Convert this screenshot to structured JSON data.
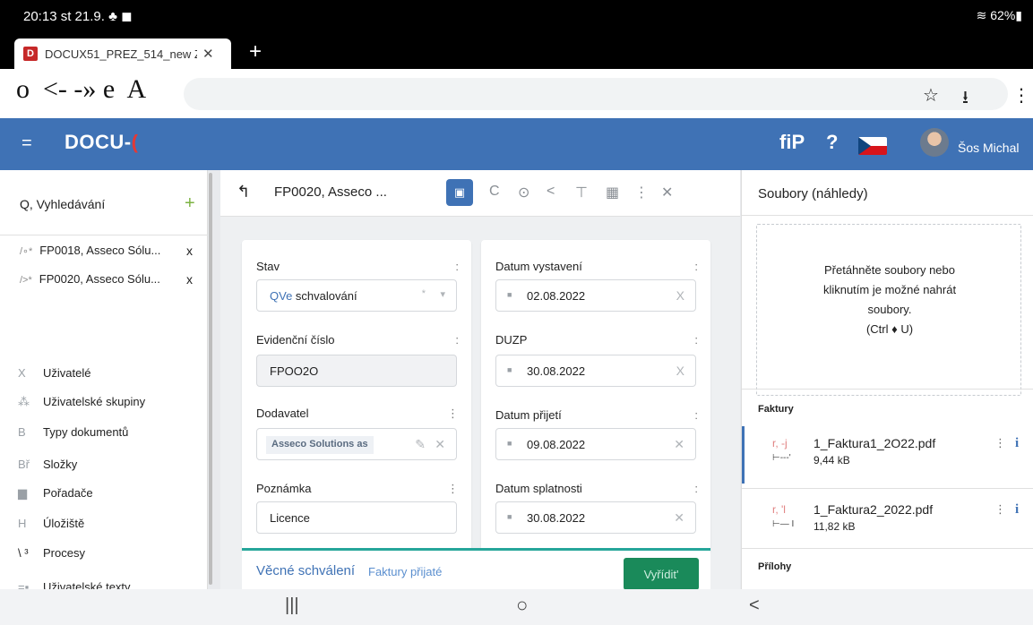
{
  "statusbar": {
    "time": "20:13  st 21.9.  ♣ ◼",
    "right": "≋ 62%▮"
  },
  "tab": {
    "favicon": "D",
    "title": "DOCUX51_PREZ_514_new Z/",
    "close": "✕",
    "new_tab": "+"
  },
  "addressbar": {
    "nav_glyphs": "o  <- -» e  A",
    "star": "☆",
    "download": "⭳",
    "menu": "⋮"
  },
  "header": {
    "menu_icon": "=",
    "logo": "DOCU-",
    "logo_mark": "(",
    "fip": "fiP",
    "help": "?",
    "username": "Šos Michal"
  },
  "colors": {
    "header_blue": "#3f72b5",
    "accent_green": "#1a8a5a",
    "teal": "#26a69a",
    "logo_red": "#e53935"
  },
  "sidebar": {
    "search_label": "Q,  Vyhledávání",
    "add_icon": "+",
    "open_docs": [
      {
        "marker": "/∘*",
        "label": "FP0018, Asseco Sólu...",
        "close": "x"
      },
      {
        "marker": "/>*",
        "label": "FP0020, Asseco Sólu...",
        "close": "x"
      }
    ],
    "items": [
      {
        "icon": "X",
        "label": "Uživatelé",
        "icon_name": "users-icon"
      },
      {
        "icon": "⁂",
        "label": "Uživatelské skupiny",
        "icon_name": "user-groups-icon"
      },
      {
        "icon": "B",
        "label": "Typy dokumentů",
        "icon_name": "document-types-icon"
      },
      {
        "icon": "Bř",
        "label": "Složky",
        "icon_name": "folders-icon"
      },
      {
        "icon": "▆",
        "label": "Pořadače",
        "icon_name": "binders-icon"
      },
      {
        "icon": "H",
        "label": "Úložiště",
        "icon_name": "storage-icon"
      },
      {
        "icon": "\\ ³",
        "label": "Procesy",
        "icon_name": "processes-icon"
      },
      {
        "icon": "=▪",
        "label": "Uživatelské texty",
        "icon_name": "user-texts-icon"
      }
    ]
  },
  "document": {
    "back_icon": "↰",
    "title": "FP0020, Asseco ...",
    "tools": {
      "save": "▣",
      "refresh": "C",
      "view": "⊙",
      "share": "<",
      "tree": "⊤",
      "grid": "▦",
      "more": "⋮",
      "close": "✕"
    },
    "left_fields": {
      "stav": {
        "label": "Stav",
        "dots": ":",
        "prefix": "QVe",
        "value": "schvalování",
        "star": "*",
        "caret": "▾"
      },
      "evidencni": {
        "label": "Evidenční číslo",
        "dots": ":",
        "value": "FPOO2O"
      },
      "dodavatel": {
        "label": "Dodavatel",
        "dots": "⋮",
        "value": "Asseco Solutions as",
        "edit": "✎",
        "clear": "✕"
      },
      "poznamka": {
        "label": "Poznámka",
        "dots": "⋮",
        "value": "Licence"
      }
    },
    "right_fields": {
      "vystaveni": {
        "label": "Datum vystavení",
        "dots": ":",
        "value": "02.08.2022",
        "clear": "X"
      },
      "duzp": {
        "label": "DUZP",
        "dots": ":",
        "value": "30.08.2022",
        "clear": "X"
      },
      "prijeti": {
        "label": "Datum přijetí",
        "dots": ":",
        "value": "09.08.2022",
        "clear": "✕"
      },
      "splatnost": {
        "label": "Datum splatnosti",
        "dots": ":",
        "value": "30.08.2022",
        "clear": "✕"
      }
    },
    "calendar_icon": "■",
    "approval": {
      "title": "Věcné schválení",
      "subtitle": "Faktury přijaté",
      "button": "Vyřídit'"
    }
  },
  "files": {
    "title": "Soubory (náhledy)",
    "dropzone": [
      "Přetáhněte soubory nebo",
      "kliknutím je možné nahrát",
      "soubory.",
      "(Ctrl ♦ U)"
    ],
    "faktury_label": "Faktury",
    "prilohy_label": "Přílohy",
    "items": [
      {
        "glyph1": "r, -j",
        "glyph2": "⊢---'",
        "name": "1_Faktura1_2O22.pdf",
        "size": "9,44 kB",
        "menu": "⋮",
        "info": "i"
      },
      {
        "glyph1": "r, 'l",
        "glyph2": "⊢— I",
        "name": "1_Faktura2_2022.pdf",
        "size": "11,82 kB",
        "menu": "⋮",
        "info": "i"
      }
    ]
  },
  "navbar": {
    "recents": "|||",
    "home": "○",
    "back": "<"
  }
}
